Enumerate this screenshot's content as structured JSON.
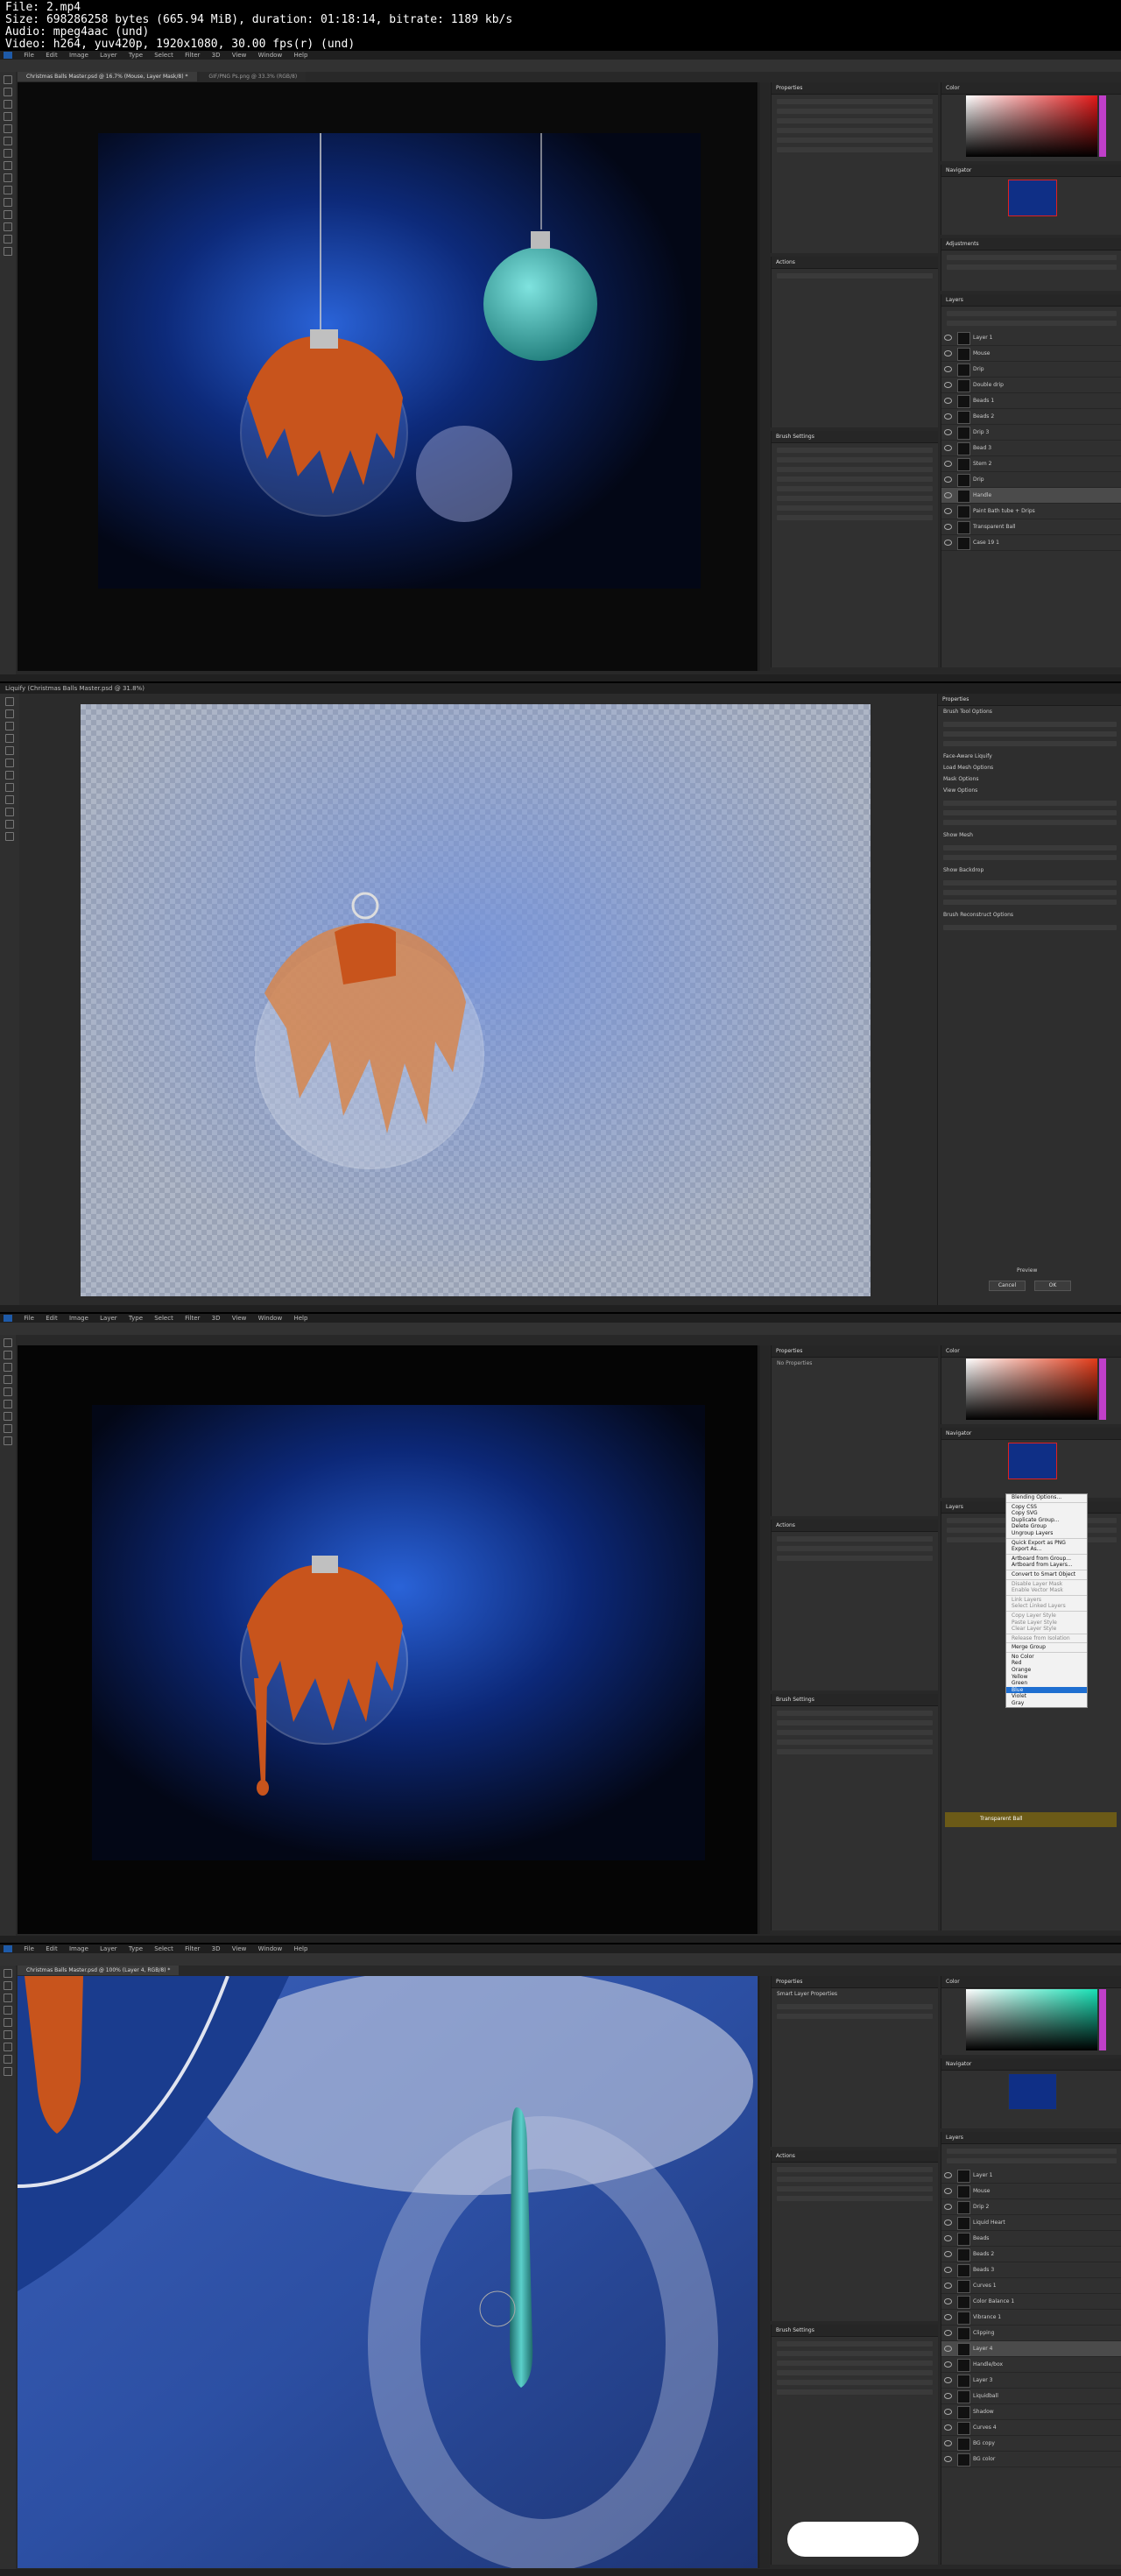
{
  "file_info": {
    "line1": "File: 2.mp4",
    "line2": "Size: 698286258 bytes (665.94 MiB), duration: 01:18:14, bitrate: 1189 kb/s",
    "line3": "Audio: mpeg4aac (und)",
    "line4": "Video: h264, yuv420p, 1920x1080, 30.00 fps(r) (und)"
  },
  "menu": [
    "File",
    "Edit",
    "Image",
    "Layer",
    "Type",
    "Select",
    "Filter",
    "3D",
    "View",
    "Window",
    "Help"
  ],
  "frame1": {
    "tab1": "Christmas Balls Master.psd @ 16.7% (Mouse, Layer Mask/8) *",
    "tab2": "GIF/PNG Ps.png @ 33.3% (RGB/8)",
    "properties_title": "Properties",
    "actions_title": "Actions",
    "brush_title": "Brush Settings",
    "color_title": "Color",
    "navigator_title": "Navigator",
    "adjustments_title": "Adjustments",
    "layers_title": "Layers",
    "layers": [
      "Layer 1",
      "Mouse",
      "Drip",
      "Double drip",
      "Beads 1",
      "Beads 2",
      "Drip 3",
      "Bead 3",
      "Stem 2",
      "Drip",
      "Handle",
      "Paint Bath tube + Drips",
      "Transparent Ball",
      "Case 19 1"
    ]
  },
  "frame2": {
    "title": "Liquify (Christmas Balls Master.psd @ 31.8%)",
    "properties": "Properties",
    "brush_tool_options": "Brush Tool Options",
    "face_aware": "Face-Aware Liquify",
    "load_mesh": "Load Mesh Options",
    "mask_options": "Mask Options",
    "view_options": "View Options",
    "show_mesh": "Show Mesh",
    "show_backdrop": "Show Backdrop",
    "brush_reconstruct": "Brush Reconstruct Options",
    "preview": "Preview",
    "cancel": "Cancel",
    "ok": "OK"
  },
  "frame3": {
    "properties_empty": "No Properties",
    "context_menu": [
      "Blending Options...",
      "Copy CSS",
      "Copy SVG",
      "Duplicate Group...",
      "Delete Group",
      "Ungroup Layers",
      "Quick Export as PNG",
      "Export As...",
      "Artboard from Group...",
      "Artboard from Layers...",
      "Convert to Smart Object",
      "Disable Layer Mask",
      "Enable Vector Mask",
      "Link Layers",
      "Select Linked Layers",
      "Copy Layer Style",
      "Paste Layer Style",
      "Clear Layer Style",
      "Release from Isolation",
      "Merge Group",
      "No Color",
      "Red",
      "Orange",
      "Yellow",
      "Green",
      "Blue",
      "Violet",
      "Gray"
    ],
    "highlighted_item": "Blue",
    "bottom_layer": "Transparent Ball"
  },
  "frame4": {
    "tab": "Christmas Balls Master.psd @ 100% (Layer 4, RGB/8) *",
    "properties": "Smart Layer Properties",
    "layers": [
      "Layer 1",
      "Mouse",
      "Drip 2",
      "Liquid Heart",
      "Beads",
      "Beads 2",
      "Beads 3",
      "Curves 1",
      "Color Balance 1",
      "Vibrance 1",
      "Clipping",
      "Layer 4",
      "Handle/box",
      "Layer 3",
      "Liquidball",
      "Shadow",
      "Curves 4",
      "BG copy",
      "BG color"
    ]
  },
  "colors": {
    "bg_blue": "#1d4db8",
    "orange": "#c8541c",
    "teal": "#3fb9b5",
    "menu_highlight": "#1f6fd1"
  }
}
